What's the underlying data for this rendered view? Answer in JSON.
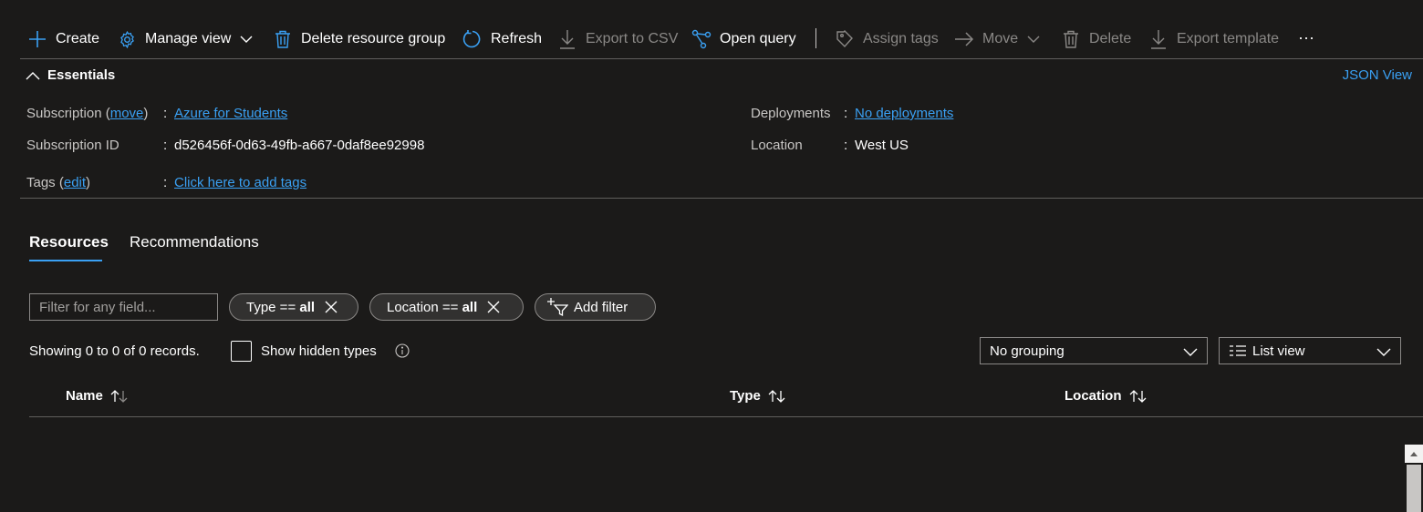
{
  "colors": {
    "background": "#1b1a19",
    "accent": "#3aa0f3",
    "disabled": "#8a8886",
    "border": "#605e5c"
  },
  "toolbar": {
    "create": {
      "label": "Create",
      "icon": "plus-icon"
    },
    "manage_view": {
      "label": "Manage view",
      "icon": "gear-icon"
    },
    "delete_resource_group": {
      "label": "Delete resource group",
      "icon": "trash-icon"
    },
    "refresh": {
      "label": "Refresh",
      "icon": "refresh-icon"
    },
    "export_csv": {
      "label": "Export to CSV",
      "icon": "download-icon",
      "disabled": true
    },
    "open_query": {
      "label": "Open query",
      "icon": "query-icon"
    },
    "assign_tags": {
      "label": "Assign tags",
      "icon": "tag-icon",
      "disabled": true
    },
    "move": {
      "label": "Move",
      "icon": "arrow-right-icon",
      "disabled": true
    },
    "delete": {
      "label": "Delete",
      "icon": "trash-icon",
      "disabled": true
    },
    "export_template": {
      "label": "Export template",
      "icon": "download-icon",
      "disabled": true
    },
    "more": {
      "label": "···",
      "icon": "more-icon"
    }
  },
  "essentials": {
    "title": "Essentials",
    "json_view": "JSON View",
    "subscription_label": "Subscription (",
    "subscription_move": "move",
    "subscription_label_end": ")",
    "subscription_value": "Azure for Students",
    "subscription_id_label": "Subscription ID",
    "subscription_id_value": "d526456f-0d63-49fb-a667-0daf8ee92998",
    "tags_label": "Tags (",
    "tags_edit": "edit",
    "tags_label_end": ")",
    "tags_value": "Click here to add tags",
    "deployments_label": "Deployments",
    "deployments_value": "No deployments",
    "location_label": "Location",
    "location_value": "West US",
    "colon": ":"
  },
  "tabs": [
    {
      "label": "Resources",
      "active": true
    },
    {
      "label": "Recommendations",
      "active": false
    }
  ],
  "filters": {
    "search_placeholder": "Filter for any field...",
    "type_pill": {
      "prefix": "Type == ",
      "value": "all"
    },
    "location_pill": {
      "prefix": "Location == ",
      "value": "all"
    },
    "add_filter": "Add filter"
  },
  "records": {
    "summary": "Showing 0 to 0 of 0 records.",
    "show_hidden_label": "Show hidden types",
    "show_hidden_checked": false
  },
  "grouping": {
    "selected": "No grouping"
  },
  "view": {
    "selected": "List view"
  },
  "table": {
    "columns": [
      "Name",
      "Type",
      "Location"
    ],
    "rows": []
  }
}
